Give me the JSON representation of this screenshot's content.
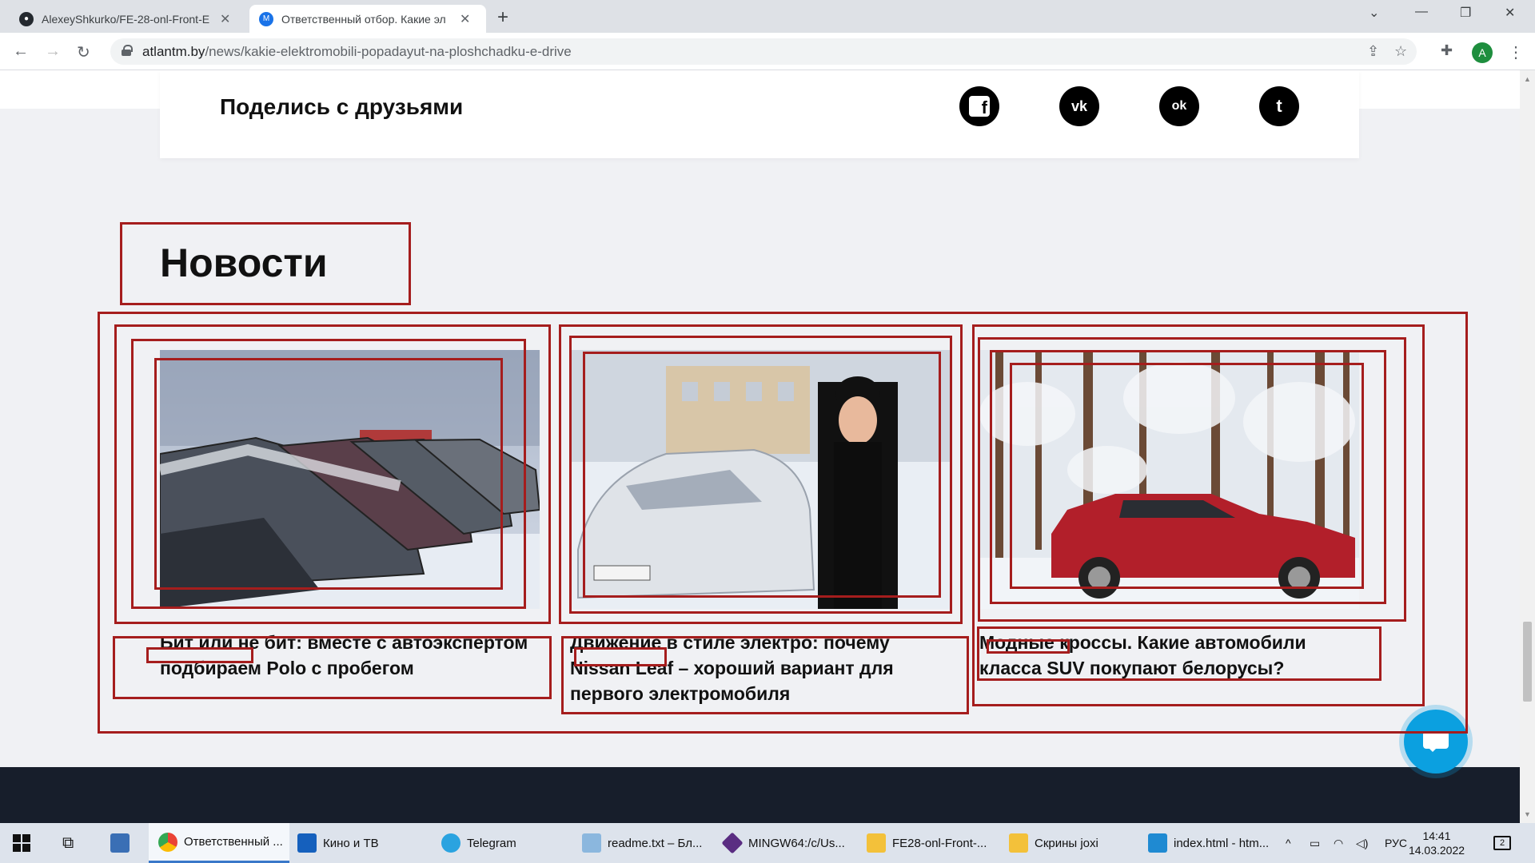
{
  "browser": {
    "tabs": [
      {
        "title": "AlexeyShkurko/FE-28-onl-Front-E",
        "favicon": "github-icon"
      },
      {
        "title": "Ответственный отбор. Какие эл",
        "favicon": "m-icon",
        "favicon_text": "M"
      }
    ],
    "url_host": "atlantm.by",
    "url_path": "/news/kakie-elektromobili-popadayut-na-ploshchadku-e-drive",
    "profile_initial": "A"
  },
  "share": {
    "title": "Поделись с друзьями",
    "icons": [
      "facebook-icon",
      "vk-icon",
      "odnoklassniki-icon",
      "twitter-icon"
    ],
    "icon_text": {
      "facebook": "f",
      "vk": "vk",
      "ok": "ok",
      "twitter": "t"
    }
  },
  "news": {
    "title": "Новости",
    "cards": [
      {
        "headline": "Бит или не бит: вместе с автоэкспертом подбираем Polo с пробегом"
      },
      {
        "headline": "Движение в стиле электро: почему Nissan Leaf – хороший вариант для первого электромобиля"
      },
      {
        "headline": "Модные кроссы. Какие автомобили класса SUV покупают белорусы?"
      }
    ]
  },
  "taskbar": {
    "items": [
      {
        "label": "Ответственный ..."
      },
      {
        "label": "Кино и ТВ"
      },
      {
        "label": "Telegram"
      },
      {
        "label": "readme.txt – Бл..."
      },
      {
        "label": "MINGW64:/c/Us..."
      },
      {
        "label": "FE28-onl-Front-..."
      },
      {
        "label": "Скрины joxi"
      },
      {
        "label": "index.html - htm..."
      }
    ],
    "language": "РУС",
    "time": "14:41",
    "date": "14.03.2022",
    "notifications": "2"
  },
  "colors": {
    "annotation": "#a51d1d",
    "footer": "#171e2b",
    "chat": "#0ba0e0"
  }
}
